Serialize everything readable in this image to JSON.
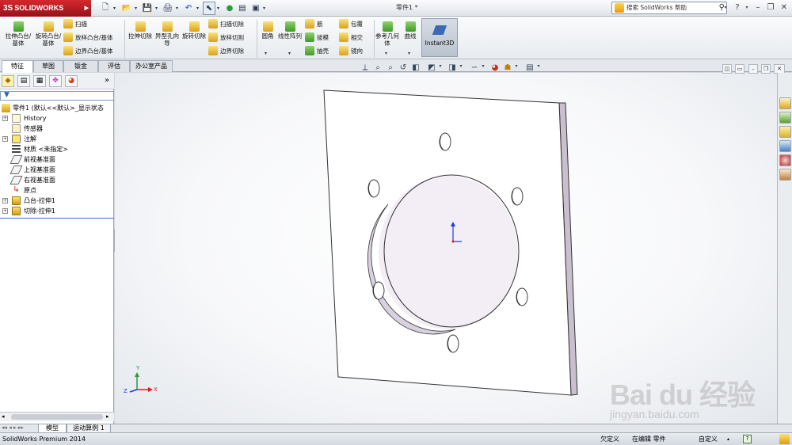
{
  "app": {
    "brand": "SOLIDWORKS",
    "brand_mark": "3S",
    "document_title": "零件1 *",
    "search_placeholder": "搜索 SolidWorks 帮助"
  },
  "quick_access": [
    {
      "name": "new-icon",
      "glyph": "🗋"
    },
    {
      "name": "open-icon",
      "glyph": "📂"
    },
    {
      "name": "save-icon",
      "glyph": "💾"
    },
    {
      "name": "print-icon",
      "glyph": "🖨"
    },
    {
      "name": "undo-icon",
      "glyph": "↶"
    },
    {
      "name": "select-icon",
      "glyph": "⬉"
    },
    {
      "name": "rebuild-icon",
      "glyph": "🚦"
    },
    {
      "name": "file-props-icon",
      "glyph": "▤"
    },
    {
      "name": "options-icon",
      "glyph": "▣"
    }
  ],
  "ribbon": {
    "boss_extrude": "拉伸凸台/基体",
    "revolve_boss": "旋转凸台/基体",
    "sweep": "扫描",
    "loft_boss": "放样凸台/基体",
    "boundary_boss": "边界凸台/基体",
    "cut_extrude": "拉伸切除",
    "hole_wizard": "异型孔向导",
    "revolve_cut": "旋转切除",
    "swept_cut": "扫描切除",
    "lofted_cut": "放样切割",
    "boundary_cut": "边界切除",
    "fillet": "圆角",
    "linear_pattern": "线性阵列",
    "rib": "筋",
    "draft": "拔模",
    "shell": "抽壳",
    "wrap": "包覆",
    "intersect": "相交",
    "mirror": "镜向",
    "reference_geometry": "参考几何体",
    "curves": "曲线",
    "instant3d": "Instant3D"
  },
  "tabs": [
    "特征",
    "草图",
    "钣金",
    "评估",
    "办公室产品"
  ],
  "feature_tree": {
    "root": "零件1 (默认<<默认>_显示状态",
    "items": [
      "History",
      "传感器",
      "注解",
      "材质 <未指定>",
      "前视基准面",
      "上视基准面",
      "右视基准面",
      "原点",
      "凸台-拉伸1",
      "切除-拉伸1"
    ]
  },
  "bottom_tabs": [
    "模型",
    "运动算例 1"
  ],
  "status": {
    "product": "SolidWorks Premium 2014",
    "units_state": "欠定义",
    "editing": "在编辑 零件",
    "custom": "自定义"
  },
  "triad": {
    "y": "Y",
    "x": "X",
    "z": "Z"
  },
  "watermark": {
    "brand": "Bai  du 经验",
    "url": "jingyan.baidu.com"
  }
}
